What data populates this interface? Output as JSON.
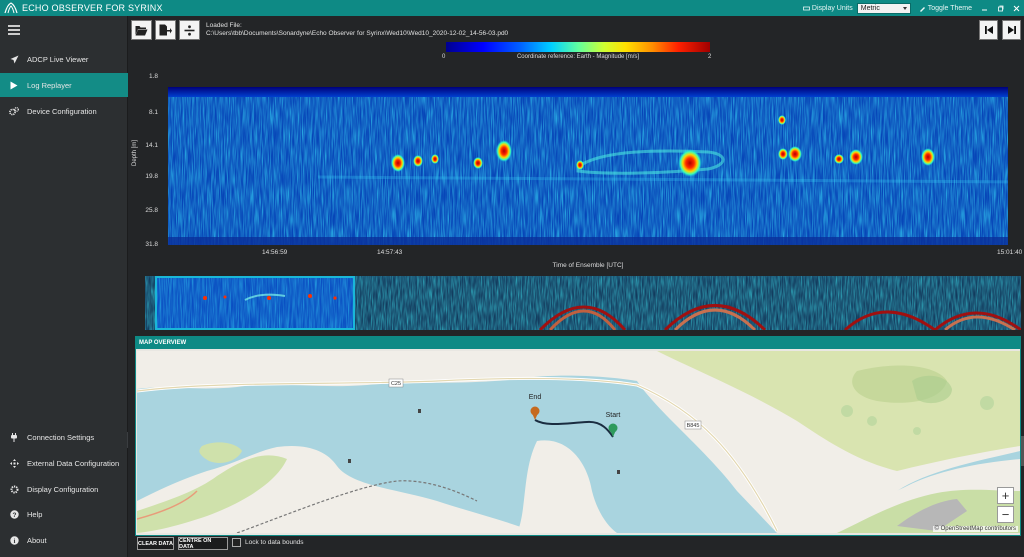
{
  "app": {
    "title": "ECHO OBSERVER FOR SYRINX",
    "display_units_label": "Display Units",
    "display_units_value": "Metric",
    "toggle_theme_label": "Toggle Theme"
  },
  "sidebar": {
    "items": [
      {
        "label": "ADCP Live Viewer",
        "icon": "paper-plane-icon"
      },
      {
        "label": "Log Replayer",
        "icon": "play-icon",
        "active": true
      },
      {
        "label": "Device Configuration",
        "icon": "gears-icon"
      }
    ],
    "bottom_items": [
      {
        "label": "Connection Settings",
        "icon": "plug-icon"
      },
      {
        "label": "External Data Configuration",
        "icon": "arrows-icon"
      },
      {
        "label": "Display Configuration",
        "icon": "gear-icon"
      },
      {
        "label": "Help",
        "icon": "help-icon"
      },
      {
        "label": "About",
        "icon": "info-icon"
      }
    ]
  },
  "toolbar": {
    "loaded_label": "Loaded File:",
    "loaded_path": "C:\\Users\\tbb\\Documents\\Sonardyne\\Echo Observer for Syrinx\\Wed10\\Wed10_2020-12-02_14-56-03.pd0"
  },
  "colorbar": {
    "min": "0",
    "max": "2",
    "label": "Coordinate reference: Earth - Magnitude [m/s]"
  },
  "chart_data": {
    "type": "heatmap",
    "ylabel": "Depth [m]",
    "xlabel": "Time of Ensemble [UTC]",
    "y_ticks": [
      "1.8",
      "8.1",
      "14.1",
      "19.8",
      "25.8",
      "31.8"
    ],
    "x_ticks": [
      "14:56:59",
      "14:57:43",
      "15:01:40"
    ],
    "colorbar_range": [
      0,
      2
    ]
  },
  "map": {
    "header": "MAP OVERVIEW",
    "start_label": "Start",
    "end_label": "End",
    "road_labels": [
      "C25",
      "B845"
    ],
    "attribution": "© OpenStreetMap contributors",
    "zoom_in": "+",
    "zoom_out": "−"
  },
  "controls": {
    "clear_data": "CLEAR DATA",
    "centre_on_data": "CENTRE ON DATA",
    "lock_label": "Lock to data bounds"
  }
}
